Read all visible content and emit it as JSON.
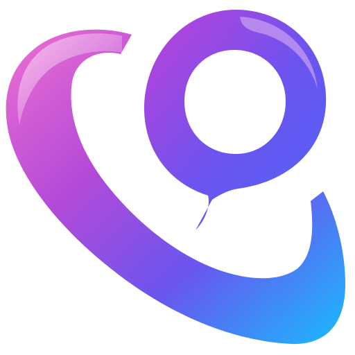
{
  "app_icon": {
    "icon_name": "phone-chat-bubble-logo-icon",
    "colors": {
      "pink": "#EE6FD1",
      "magenta": "#B34AD8",
      "violet": "#7A4BEF",
      "blue": "#4D66F6",
      "cyan": "#19BBFF",
      "lavender": "#C59CF0"
    }
  }
}
